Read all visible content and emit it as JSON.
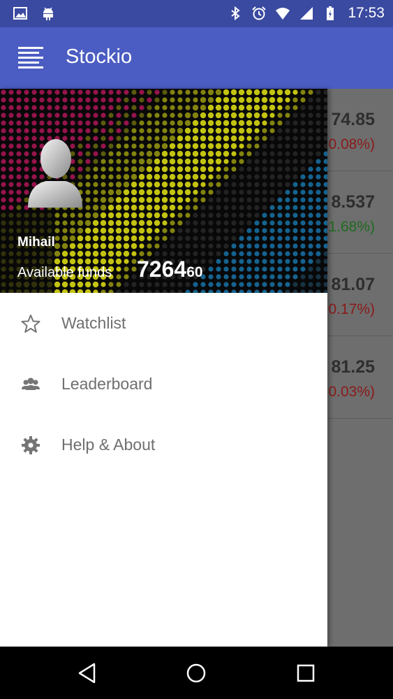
{
  "status_bar": {
    "time": "17:53",
    "left_icons": [
      "image-icon",
      "android-icon"
    ],
    "right_icons": [
      "bluetooth-icon",
      "alarm-icon",
      "wifi-icon",
      "signal-icon",
      "battery-icon"
    ]
  },
  "app_bar": {
    "title": "Stockio",
    "menu_icon": "hamburger-menu-icon",
    "color": "#4b5dc2"
  },
  "background_list": [
    {
      "price": "74.85",
      "change": "0.08%)",
      "color": "#8b1a1a"
    },
    {
      "price": "8.537",
      "change": "1.68%)",
      "color": "#1f6b1f"
    },
    {
      "price": "81.07",
      "change": "0.17%)",
      "color": "#8b1a1a"
    },
    {
      "price": "81.25",
      "change": "0.03%)",
      "color": "#8b1a1a"
    }
  ],
  "drawer": {
    "user_name": "Mihail",
    "funds_label": "Available funds",
    "funds_whole": "7264",
    "funds_cents": "60",
    "items": [
      {
        "label": "Watchlist",
        "icon": "star-icon"
      },
      {
        "label": "Leaderboard",
        "icon": "group-icon"
      },
      {
        "label": "Help & About",
        "icon": "gear-icon"
      }
    ]
  },
  "nav_bar": {
    "buttons": [
      "back-icon",
      "home-icon",
      "recents-icon"
    ]
  }
}
